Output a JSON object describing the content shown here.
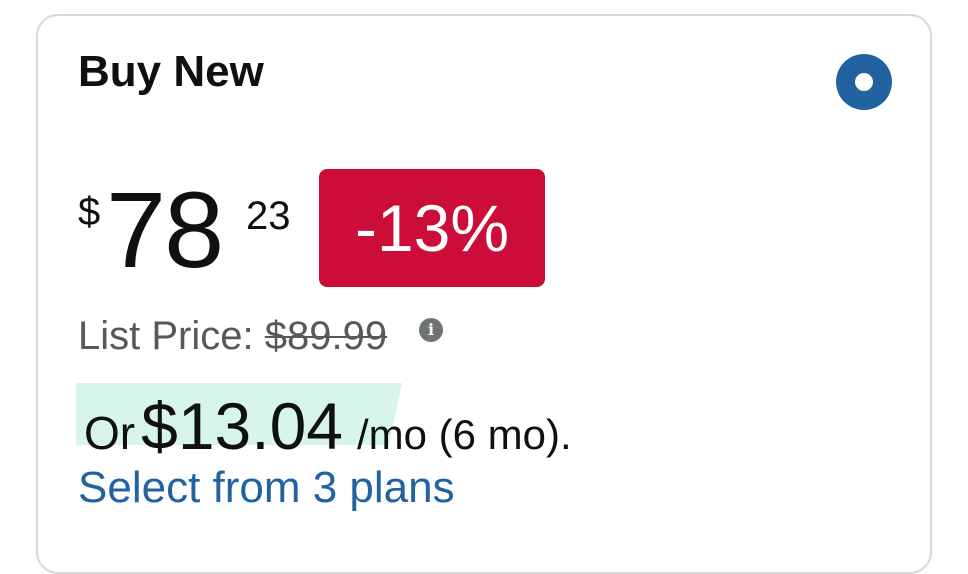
{
  "card": {
    "title": "Buy New",
    "price": {
      "symbol": "$",
      "whole": "78",
      "fraction": "23"
    },
    "discount_badge": "-13%",
    "list_price": {
      "label": "List Price:",
      "value": "$89.99"
    },
    "info_icon_glyph": "i",
    "installment": {
      "prefix": "Or",
      "amount": "$13.04",
      "term": "/mo (6 mo)."
    },
    "plans_link": "Select from 3 plans"
  },
  "colors": {
    "radio": "#2162a1",
    "discount_badge": "#cc0c39",
    "installment_highlight": "#d7f5e8",
    "link": "#2162a1"
  },
  "icons": {
    "radio": "radio-selected-icon",
    "info": "info-icon"
  }
}
